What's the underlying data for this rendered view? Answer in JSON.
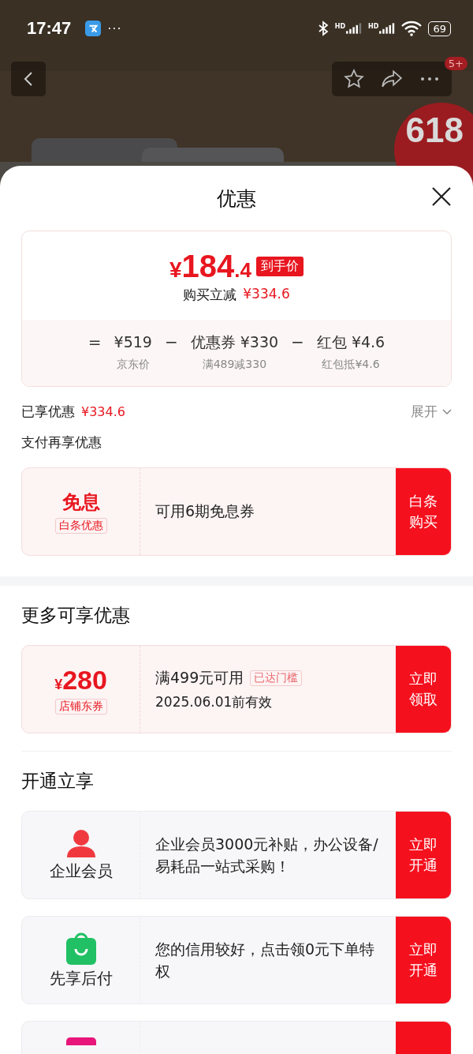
{
  "status_bar": {
    "time": "17:47",
    "more": "···",
    "hd_1": "HD",
    "hd_2": "HD",
    "battery": "69"
  },
  "nav": {
    "badge": "5+"
  },
  "promo_badge": "618",
  "sheet": {
    "title": "优惠",
    "price_card": {
      "currency": "¥",
      "integer": "184",
      "decimal": ".4",
      "tag": "到手价",
      "saving_label": "购买立减",
      "saving": "¥334.6",
      "terms": [
        {
          "op": "=",
          "amount": "¥519",
          "note": "京东价"
        },
        {
          "op": "−",
          "name": "优惠券",
          "amount": "¥330",
          "note": "满489减330"
        },
        {
          "op": "−",
          "name": "红包",
          "amount": "¥4.6",
          "note": "红包抵¥4.6"
        }
      ]
    },
    "enjoyed": {
      "label": "已享优惠",
      "amount": "¥334.6",
      "toggle": "展开",
      "expanded": false
    },
    "pay_heading": "支付再享优惠",
    "pay_coupons": [
      {
        "kind": "text",
        "title": "免息",
        "tag": "白条优惠",
        "desc": "可用6期免息券",
        "action": [
          "白条",
          "购买"
        ]
      }
    ],
    "more_heading": "更多可享优惠",
    "more_coupons": [
      {
        "kind": "amount",
        "currency": "¥",
        "amount": "280",
        "tag": "店铺东券",
        "desc": "满499元可用",
        "badge": "已达门槛",
        "validity": "2025.06.01前有效",
        "action": [
          "立即",
          "领取"
        ]
      }
    ],
    "open_heading": "开通立享",
    "open_items": [
      {
        "kind": "person",
        "color": "#f0393f",
        "name": "企业会员",
        "desc": " 企业会员3000元补贴，办公设备/易耗品一站式采购！",
        "action": [
          "立即",
          "开通"
        ]
      },
      {
        "kind": "bag",
        "color": "#22c064",
        "name": "先享后付",
        "desc": "您的信用较好，点击领0元下单特权",
        "action": [
          "立即",
          "开通"
        ]
      },
      {
        "kind": "tile",
        "color": "#e8157a"
      }
    ]
  }
}
